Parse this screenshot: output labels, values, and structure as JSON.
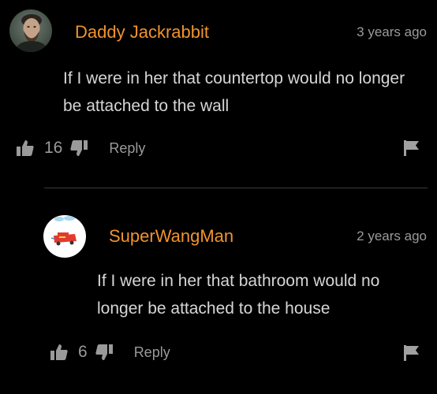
{
  "comments": [
    {
      "username": "Daddy Jackrabbit",
      "timestamp": "3 years ago",
      "text": "If I were in her that countertop would no longer be attached to the wall",
      "likes": "16",
      "reply_label": "Reply",
      "avatar_icon": "user-photo-avatar",
      "flag_icon": "flag-icon"
    },
    {
      "username": "SuperWangMan",
      "timestamp": "2 years ago",
      "text": "If I were in her that bathroom would no longer be attached to the house",
      "likes": "6",
      "reply_label": "Reply",
      "avatar_icon": "cartoon-avatar",
      "flag_icon": "flag-icon"
    }
  ],
  "colors": {
    "background": "#000000",
    "username": "#f0932e",
    "text": "#d6d6d6",
    "muted": "#9a9a9a",
    "divider": "#3a3a3a"
  }
}
